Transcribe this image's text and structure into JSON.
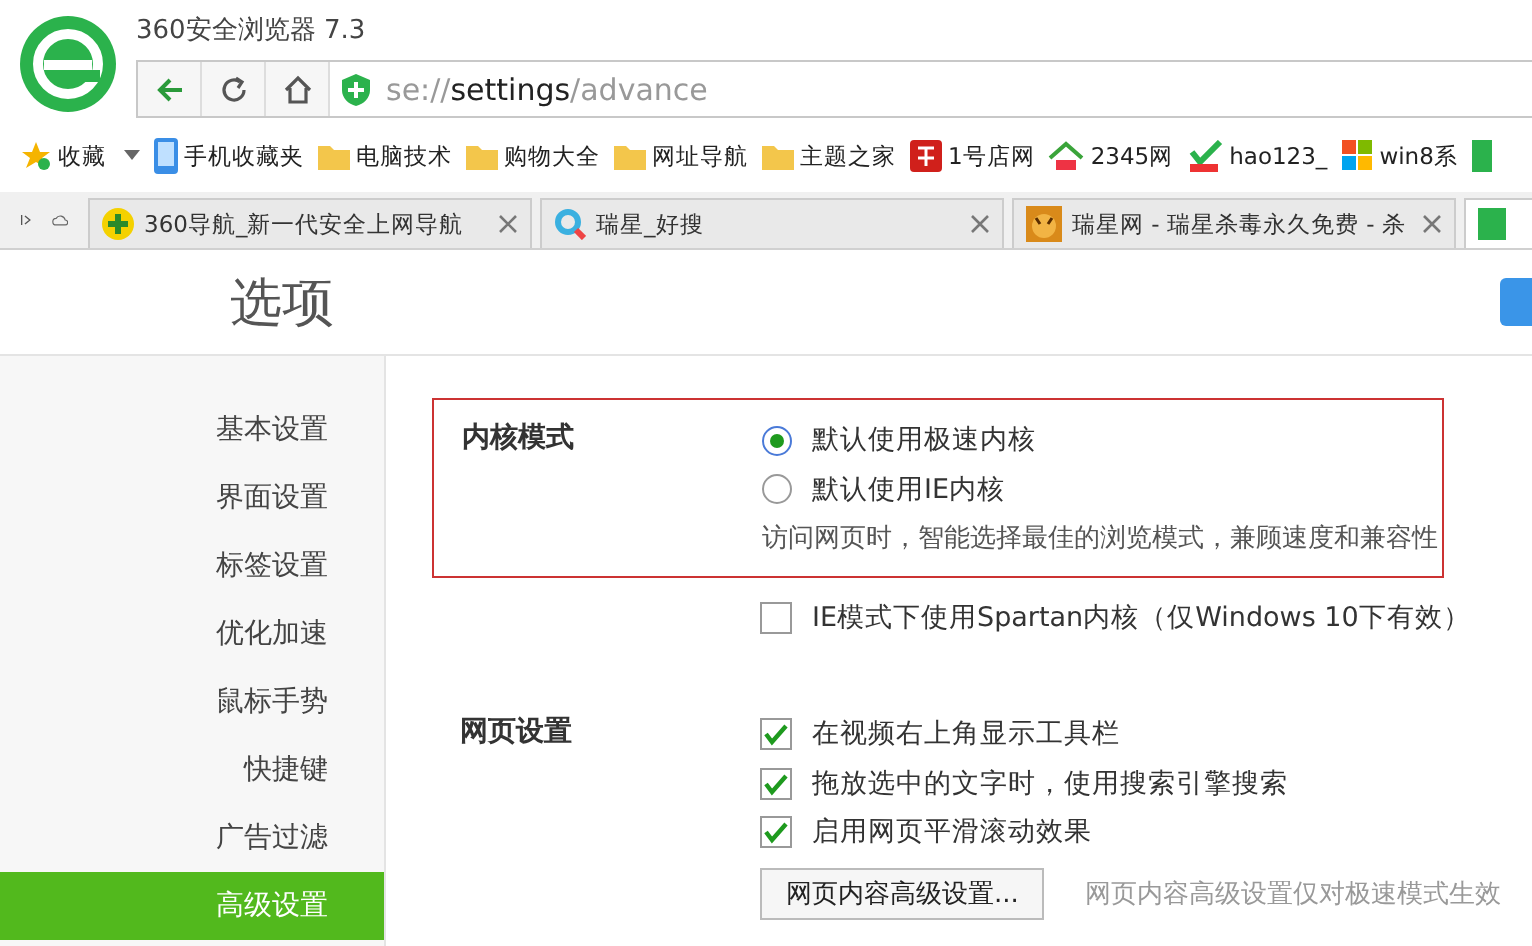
{
  "window": {
    "title": "360安全浏览器 7.3"
  },
  "address_bar": {
    "scheme": "se://",
    "host": "settings",
    "path": "/advance"
  },
  "bookmarks": [
    {
      "label": "收藏",
      "kind": "star"
    },
    {
      "label": "手机收藏夹",
      "kind": "phone"
    },
    {
      "label": "电脑技术",
      "kind": "folder"
    },
    {
      "label": "购物大全",
      "kind": "folder"
    },
    {
      "label": "网址导航",
      "kind": "folder"
    },
    {
      "label": "主题之家",
      "kind": "folder"
    },
    {
      "label": "1号店网",
      "kind": "red"
    },
    {
      "label": "2345网",
      "kind": "house"
    },
    {
      "label": "hao123_",
      "kind": "leaf"
    },
    {
      "label": "win8系",
      "kind": "windows"
    }
  ],
  "tabs": [
    {
      "title": "360导航_新一代安全上网导航",
      "kind": "plus",
      "selected": false
    },
    {
      "title": "瑞星_好搜",
      "kind": "ring",
      "selected": false
    },
    {
      "title": "瑞星网 - 瑞星杀毒永久免费 - 杀",
      "kind": "tiger",
      "selected": false
    },
    {
      "kind": "square",
      "selected": true
    }
  ],
  "page": {
    "title": "选项",
    "sidebar": [
      {
        "label": "基本设置",
        "selected": false
      },
      {
        "label": "界面设置",
        "selected": false
      },
      {
        "label": "标签设置",
        "selected": false
      },
      {
        "label": "优化加速",
        "selected": false
      },
      {
        "label": "鼠标手势",
        "selected": false
      },
      {
        "label": "快捷键",
        "selected": false
      },
      {
        "label": "广告过滤",
        "selected": false
      },
      {
        "label": "高级设置",
        "selected": true
      }
    ],
    "sections": [
      {
        "label": "内核模式",
        "highlighted": true,
        "options": [
          {
            "kind": "radio",
            "label": "默认使用极速内核",
            "selected": true
          },
          {
            "kind": "radio",
            "label": "默认使用IE内核",
            "selected": false
          },
          {
            "kind": "note",
            "text": "访问网页时，智能选择最佳的浏览模式，兼顾速度和兼容性"
          }
        ]
      },
      {
        "highlighted": false,
        "options": [
          {
            "kind": "checkbox",
            "label": "IE模式下使用Spartan内核（仅Windows 10下有效）",
            "checked": false
          }
        ]
      },
      {
        "label": "网页设置",
        "highlighted": false,
        "options": [
          {
            "kind": "checkbox",
            "label": "在视频右上角显示工具栏",
            "checked": true
          },
          {
            "kind": "checkbox",
            "label": "拖放选中的文字时，使用搜索引擎搜索",
            "checked": true
          },
          {
            "kind": "checkbox",
            "label": "启用网页平滑滚动效果",
            "checked": true
          },
          {
            "kind": "button",
            "label": "网页内容高级设置...",
            "hint": "网页内容高级设置仅对极速模式生效"
          }
        ]
      }
    ]
  }
}
